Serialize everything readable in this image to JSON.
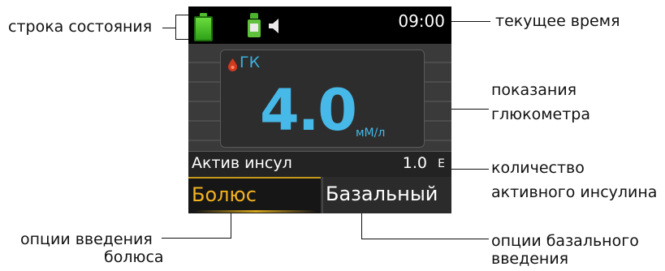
{
  "annotations": {
    "status_bar": "строка состояния",
    "current_time": "текущее время",
    "glucometer_line1": "показания",
    "glucometer_line2": "глюкометра",
    "active_insulin_line1": "количество",
    "active_insulin_line2": "активного инсулина",
    "bolus_options_line1": "опции введения",
    "bolus_options_line2": "болюса",
    "basal_options_line1": "опции базального",
    "basal_options_line2": "введения"
  },
  "device": {
    "status_bar": {
      "time": "09:00",
      "icons": [
        "battery-icon",
        "insulin-vial-icon",
        "sound-icon"
      ]
    },
    "glucose": {
      "label": "ГК",
      "value": "4.0",
      "unit": "мМ/л"
    },
    "active_insulin": {
      "label": "Актив инсул",
      "value": "1.0",
      "unit": "Е"
    },
    "buttons": {
      "bolus": "Болюс",
      "basal": "Базальный"
    },
    "colors": {
      "glucose_blue": "#46b9e8",
      "bolus_yellow": "#f3b320",
      "battery_green": "#4fbd2c"
    }
  }
}
